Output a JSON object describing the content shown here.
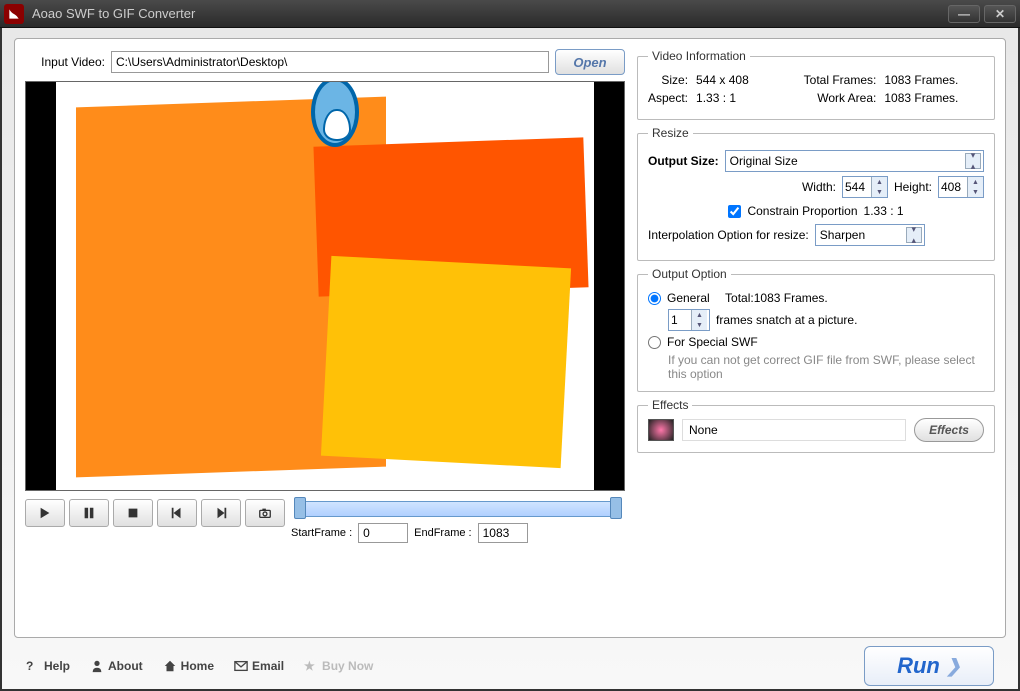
{
  "title": "Aoao SWF to GIF Converter",
  "input": {
    "label": "Input Video:",
    "value": "C:\\Users\\Administrator\\Desktop\\",
    "open_label": "Open"
  },
  "playback": {
    "start_frame_label": "StartFrame :",
    "start_frame_value": "0",
    "end_frame_label": "EndFrame :",
    "end_frame_value": "1083"
  },
  "video_info": {
    "legend": "Video Information",
    "size_label": "Size:",
    "size_value": "544 x 408",
    "total_frames_label": "Total Frames:",
    "total_frames_value": "1083 Frames.",
    "aspect_label": "Aspect:",
    "aspect_value": "1.33 : 1",
    "work_area_label": "Work Area:",
    "work_area_value": "1083 Frames."
  },
  "resize": {
    "legend": "Resize",
    "output_size_label": "Output Size:",
    "output_size_value": "Original Size",
    "width_label": "Width:",
    "width_value": "544",
    "height_label": "Height:",
    "height_value": "408",
    "constrain_label": "Constrain Proportion",
    "constrain_ratio": "1.33 : 1",
    "interpolation_label": "Interpolation Option for resize:",
    "interpolation_value": "Sharpen"
  },
  "output": {
    "legend": "Output Option",
    "general_label": "General",
    "total_label": "Total:1083 Frames.",
    "snatch_value": "1",
    "snatch_label": "frames snatch at a picture.",
    "special_label": "For Special SWF",
    "special_hint": "If you can not get correct GIF file from SWF, please select this option"
  },
  "effects": {
    "legend": "Effects",
    "current": "None",
    "button": "Effects"
  },
  "bottom": {
    "help": "Help",
    "about": "About",
    "home": "Home",
    "email": "Email",
    "buy": "Buy Now",
    "run": "Run"
  }
}
